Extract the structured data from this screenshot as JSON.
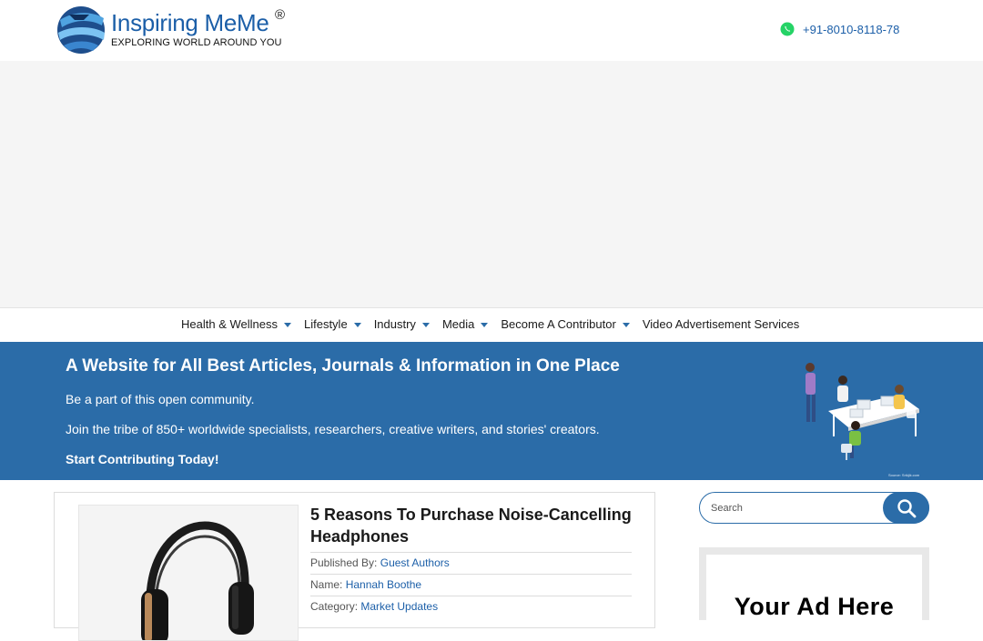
{
  "header": {
    "logo_title": "Inspiring MeMe",
    "logo_reg": "®",
    "logo_tagline": "EXPLORING WORLD AROUND YOU",
    "phone": "+91-8010-8118-78"
  },
  "nav": {
    "items": [
      {
        "label": "Health & Wellness",
        "has_dropdown": true
      },
      {
        "label": "Lifestyle",
        "has_dropdown": true
      },
      {
        "label": "Industry",
        "has_dropdown": true
      },
      {
        "label": "Media",
        "has_dropdown": true
      },
      {
        "label": "Become A Contributor",
        "has_dropdown": true
      },
      {
        "label": "Video Advertisement Services",
        "has_dropdown": false
      }
    ]
  },
  "hero": {
    "title": "A Website for All Best Articles, Journals & Information in One Place",
    "line1": "Be a part of this open community.",
    "line2": "Join the tribe of 850+ worldwide specialists, researchers, creative writers, and stories' creators.",
    "cta": "Start Contributing Today!",
    "image_source": "Source: Srikjik.com"
  },
  "post": {
    "title": "5 Reasons To Purchase Noise-Cancelling Headphones",
    "published_label": "Published By:",
    "published_value": "Guest Authors",
    "name_label": "Name:",
    "name_value": "Hannah Boothe",
    "category_label": "Category:",
    "category_value": "Market Updates"
  },
  "sidebar": {
    "search_placeholder": "Search",
    "ad_text": "Your Ad Here"
  },
  "colors": {
    "brand_blue": "#2b6ca8",
    "link_blue": "#1c5fa8",
    "whatsapp_green": "#25d366"
  }
}
